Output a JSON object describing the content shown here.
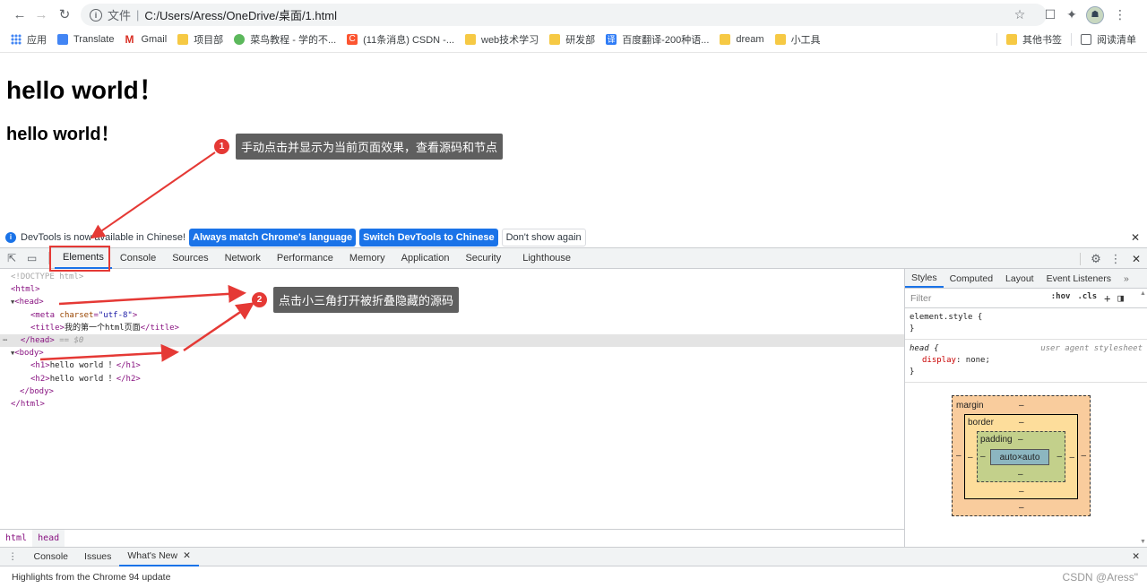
{
  "browser": {
    "url_scheme": "文件",
    "url_sep": "|",
    "url_path": "C:/Users/Aress/OneDrive/桌面/1.html"
  },
  "bookmarks": [
    {
      "label": "应用",
      "icon": "apps-grid-icon"
    },
    {
      "label": "Translate",
      "icon": "translate-icon"
    },
    {
      "label": "Gmail",
      "icon": "gmail-icon"
    },
    {
      "label": "项目部",
      "icon": "folder-icon"
    },
    {
      "label": "菜鸟教程 - 学的不...",
      "icon": "runoob-icon"
    },
    {
      "label": "(11条消息) CSDN -...",
      "icon": "csdn-icon"
    },
    {
      "label": "web技术学习",
      "icon": "folder-icon"
    },
    {
      "label": "研发部",
      "icon": "folder-icon"
    },
    {
      "label": "百度翻译-200种语...",
      "icon": "baidu-translate-icon"
    },
    {
      "label": "dream",
      "icon": "folder-icon"
    },
    {
      "label": "小工具",
      "icon": "folder-icon"
    }
  ],
  "bookmarks_right": [
    {
      "label": "其他书签",
      "icon": "folder-icon"
    },
    {
      "label": "阅读清单",
      "icon": "reading-list-icon"
    }
  ],
  "page": {
    "h1": "hello world！",
    "h2": "hello world！"
  },
  "callouts": [
    {
      "num": "1",
      "text": "手动点击并显示为当前页面效果，查看源码和节点"
    },
    {
      "num": "2",
      "text": "点击小三角打开被折叠隐藏的源码"
    }
  ],
  "notification": {
    "message": "DevTools is now available in Chinese!",
    "btn_match": "Always match Chrome's language",
    "btn_switch": "Switch DevTools to Chinese",
    "btn_dismiss": "Don't show again"
  },
  "devtools_tabs": [
    "Elements",
    "Console",
    "Sources",
    "Network",
    "Performance",
    "Memory",
    "Application",
    "Security",
    "Lighthouse"
  ],
  "dom": {
    "doctype": "<!DOCTYPE html>",
    "html_open": "<html>",
    "head_open": "<head>",
    "meta_tag": "meta",
    "meta_attr": "charset",
    "meta_val": "\"utf-8\"",
    "title_open": "<title>",
    "title_text": "我的第一个html页面",
    "title_close": "</title>",
    "head_close": "</head>",
    "eq0": "== $0",
    "body_open": "<body>",
    "h1_open": "<h1>",
    "h1_text": "hello world ！",
    "h1_close": "</h1>",
    "h2_open": "<h2>",
    "h2_text": "hello world ！",
    "h2_close": "</h2>",
    "body_close": "</body>",
    "html_close": "</html>"
  },
  "breadcrumbs": [
    "html",
    "head"
  ],
  "styles_tabs": [
    "Styles",
    "Computed",
    "Layout",
    "Event Listeners"
  ],
  "styles": {
    "filter_placeholder": "Filter",
    "hov": ":hov",
    "cls": ".cls",
    "element_style": "element.style {",
    "close_brace": "}",
    "head_selector": "head {",
    "origin": "user agent stylesheet",
    "prop": "display",
    "val": "none;"
  },
  "boxmodel": {
    "margin": "margin",
    "border": "border",
    "padding": "padding",
    "content": "auto×auto",
    "dash": "–"
  },
  "drawer_tabs": [
    "Console",
    "Issues",
    "What's New"
  ],
  "drawer_update": "Highlights from the Chrome 94 update",
  "watermark": "CSDN @Aress\""
}
